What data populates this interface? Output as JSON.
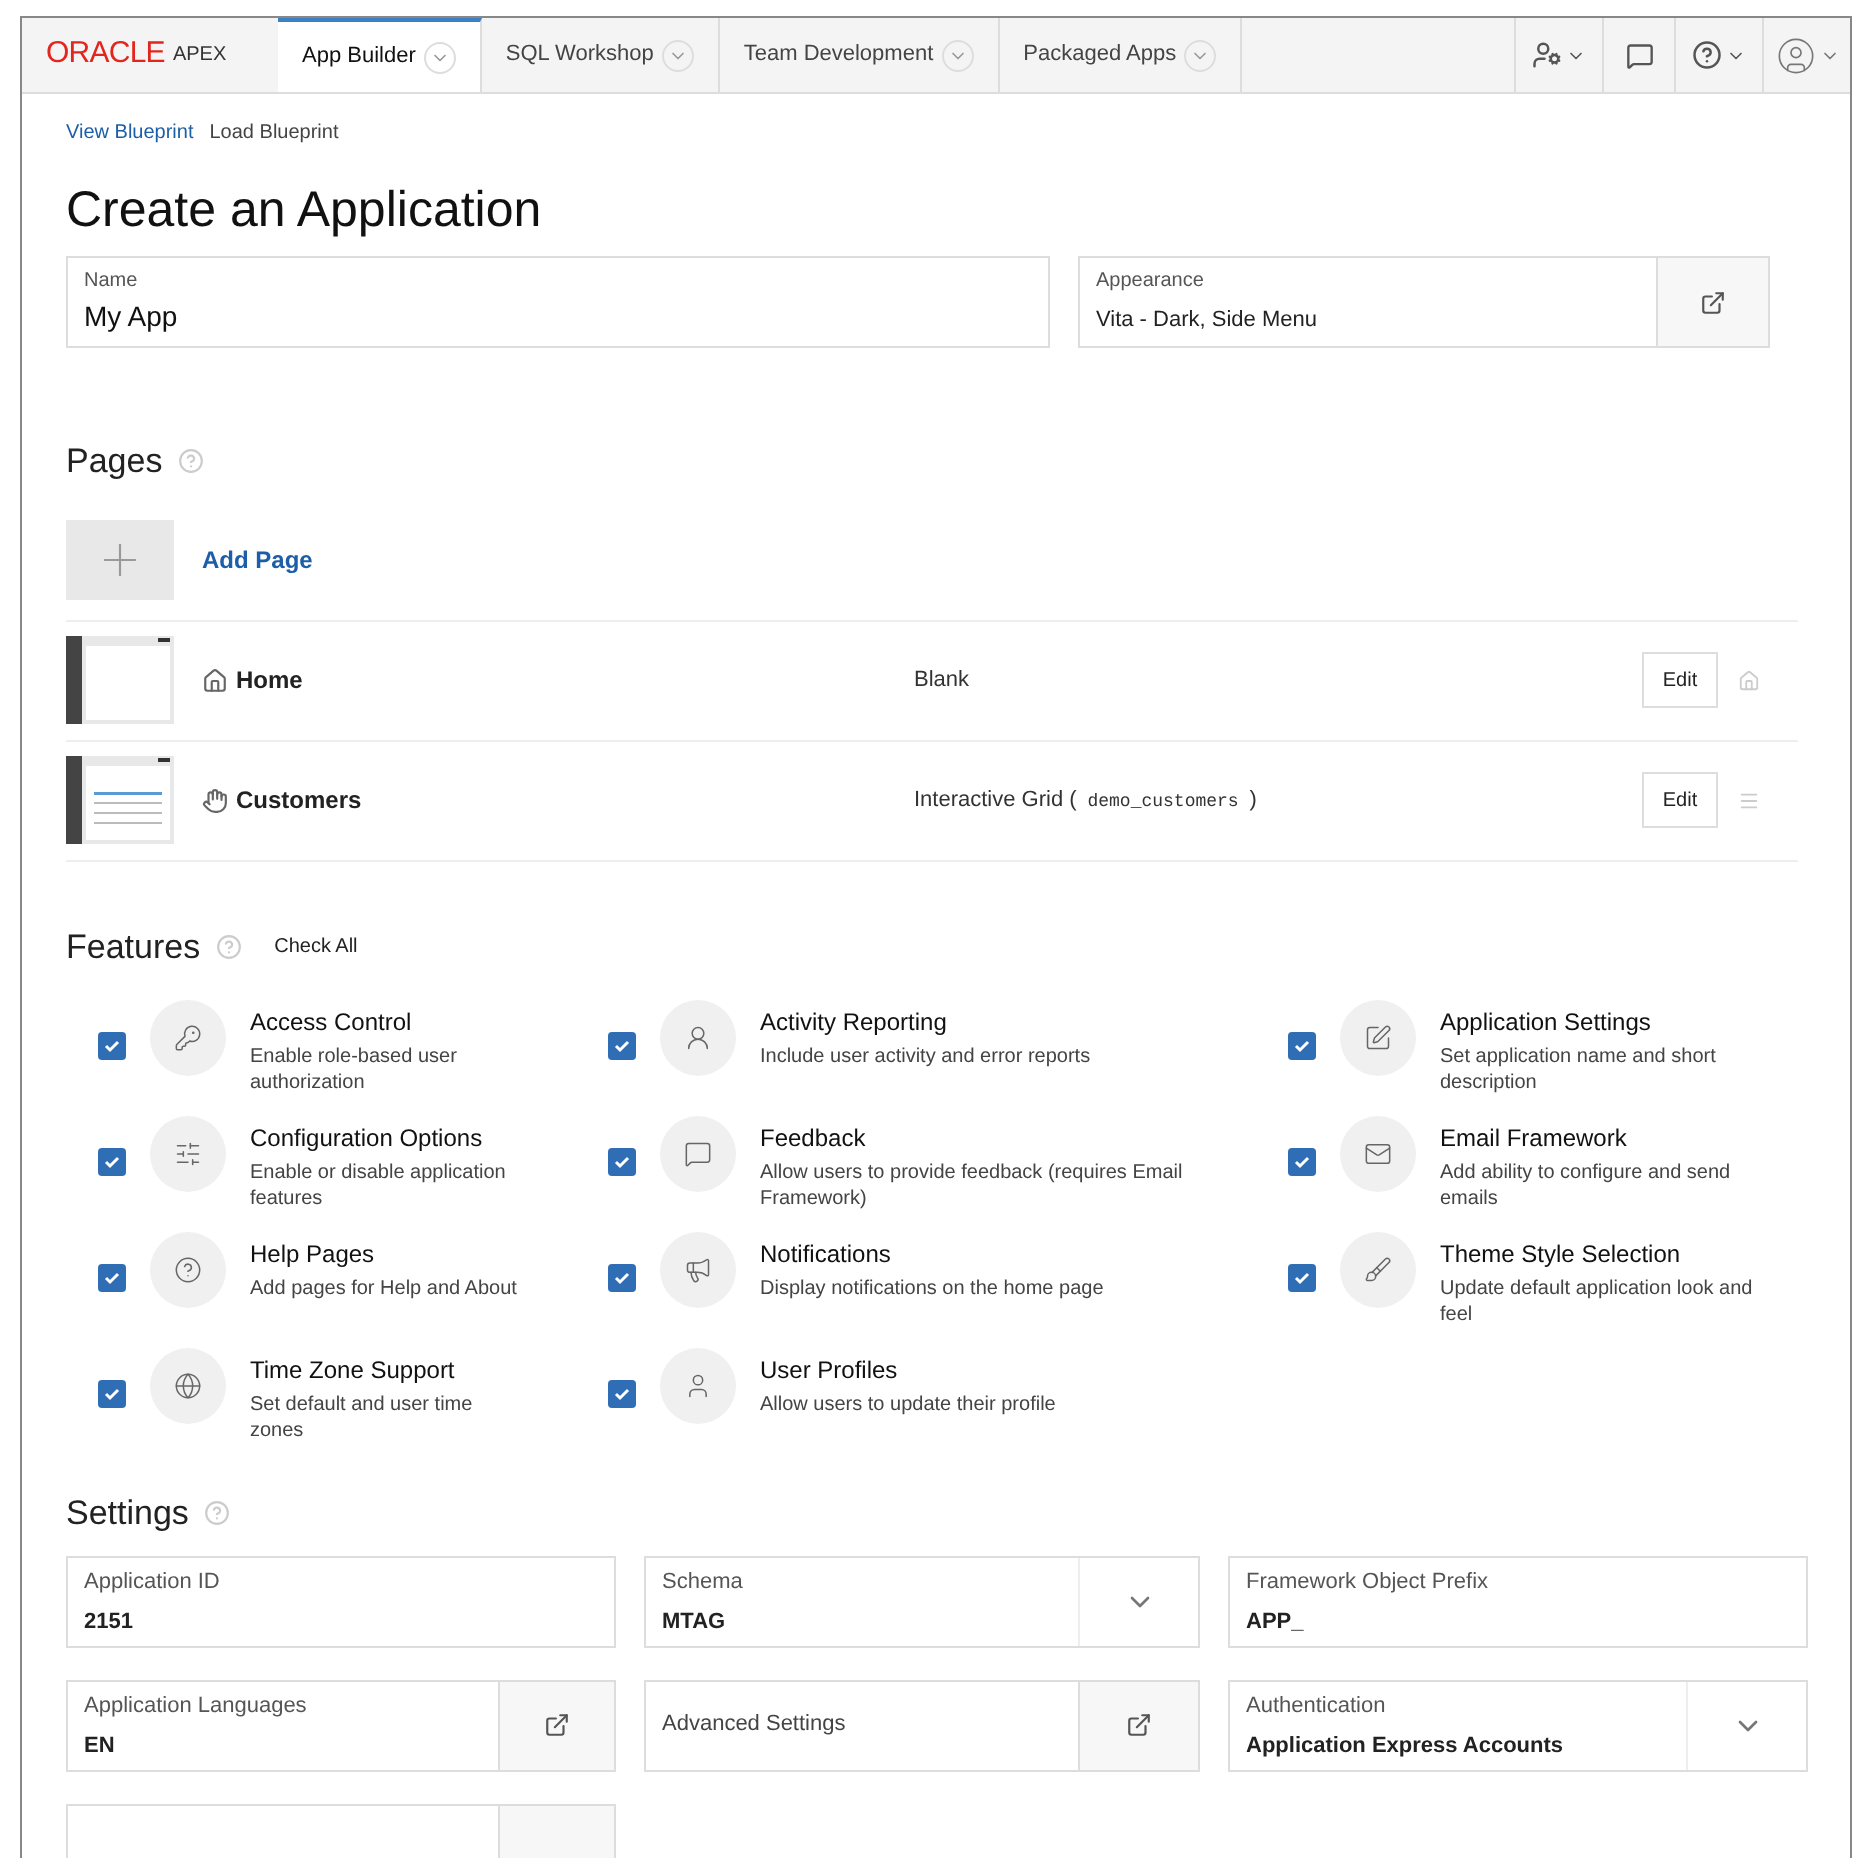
{
  "nav": {
    "logo": {
      "brand": "ORACLE",
      "product": "APEX"
    },
    "tabs": [
      {
        "label": "App Builder",
        "selected": true
      },
      {
        "label": "SQL Workshop",
        "selected": false
      },
      {
        "label": "Team Development",
        "selected": false
      },
      {
        "label": "Packaged Apps",
        "selected": false
      }
    ]
  },
  "breadcrumbs": [
    {
      "label": "View Blueprint",
      "kind": "link"
    },
    {
      "label": "Load Blueprint",
      "kind": "text"
    }
  ],
  "title": "Create an Application",
  "name_field": {
    "label": "Name",
    "value": "My App"
  },
  "appearance_field": {
    "label": "Appearance",
    "value": "Vita - Dark, Side Menu"
  },
  "pages": {
    "heading": "Pages",
    "add_label": "Add Page",
    "items": [
      {
        "kind": "home",
        "name": "Home",
        "type": "Blank",
        "edit": "Edit"
      },
      {
        "kind": "grid",
        "name": "Customers",
        "type": "Interactive Grid (",
        "source": "demo_customers",
        "type_end": ")",
        "edit": "Edit"
      }
    ]
  },
  "features": {
    "heading": "Features",
    "check_all": "Check All",
    "items": [
      {
        "title": "Access Control",
        "desc": "Enable role-based user authorization",
        "checked": true
      },
      {
        "title": "Activity Reporting",
        "desc": "Include user activity and error reports",
        "checked": true
      },
      {
        "title": "Application Settings",
        "desc": "Set application name and short description",
        "checked": true
      },
      {
        "title": "Configuration Options",
        "desc": "Enable or disable application features",
        "checked": true
      },
      {
        "title": "Feedback",
        "desc": "Allow users to provide feedback (requires Email Framework)",
        "checked": true
      },
      {
        "title": "Email Framework",
        "desc": "Add ability to configure and send emails",
        "checked": true
      },
      {
        "title": "Help Pages",
        "desc": "Add pages for Help and About",
        "checked": true
      },
      {
        "title": "Notifications",
        "desc": "Display notifications on the home page",
        "checked": true
      },
      {
        "title": "Theme Style Selection",
        "desc": "Update default application look and feel",
        "checked": true
      },
      {
        "title": "Time Zone Support",
        "desc": "Set default and user time zones",
        "checked": true
      },
      {
        "title": "User Profiles",
        "desc": "Allow users to update their profile",
        "checked": true
      }
    ]
  },
  "settings": {
    "heading": "Settings",
    "fields": [
      {
        "kind": "text",
        "label": "Application ID",
        "value": "2151"
      },
      {
        "kind": "select",
        "label": "Schema",
        "value": "MTAG"
      },
      {
        "kind": "text",
        "label": "Framework Object Prefix",
        "value": "APP_"
      },
      {
        "kind": "popup",
        "label": "Application Languages",
        "value": "EN"
      },
      {
        "kind": "button",
        "label": "Advanced Settings"
      },
      {
        "kind": "select",
        "label": "Authentication",
        "value": "Application Express Accounts"
      }
    ]
  }
}
